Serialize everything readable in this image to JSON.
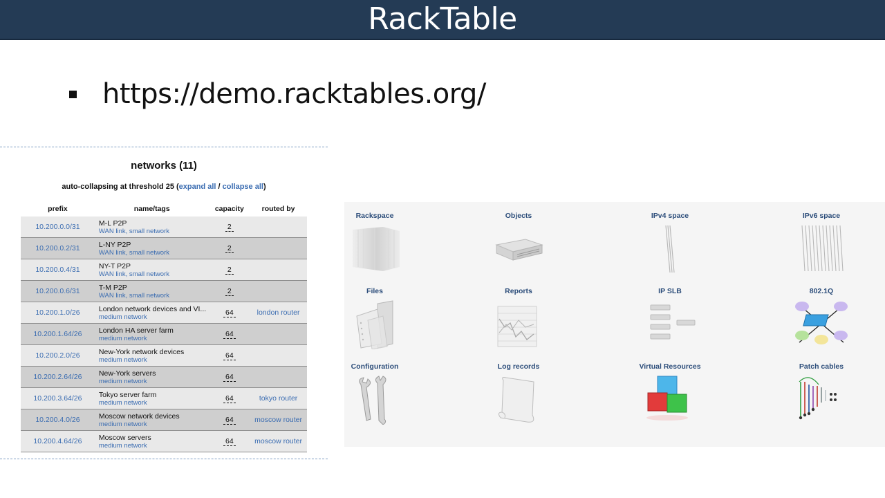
{
  "slide": {
    "title": "RackTable",
    "bullet_url": "https://demo.racktables.org/"
  },
  "networks": {
    "title": "networks (11)",
    "subtitle_prefix": "auto-collapsing at threshold 25 (",
    "expand_all": "expand all",
    "separator": " / ",
    "collapse_all": "collapse all",
    "subtitle_suffix": ")",
    "headers": {
      "prefix": "prefix",
      "name": "name/tags",
      "capacity": "capacity",
      "routed": "routed by"
    },
    "rows": [
      {
        "prefix": "10.200.0.0/31",
        "name": "M-L P2P",
        "tag1": "WAN link",
        "tag2": "small network",
        "capacity": "2",
        "routed": ""
      },
      {
        "prefix": "10.200.0.2/31",
        "name": "L-NY P2P",
        "tag1": "WAN link",
        "tag2": "small network",
        "capacity": "2",
        "routed": ""
      },
      {
        "prefix": "10.200.0.4/31",
        "name": "NY-T P2P",
        "tag1": "WAN link",
        "tag2": "small network",
        "capacity": "2",
        "routed": ""
      },
      {
        "prefix": "10.200.0.6/31",
        "name": "T-M P2P",
        "tag1": "WAN link",
        "tag2": "small network",
        "capacity": "2",
        "routed": ""
      },
      {
        "prefix": "10.200.1.0/26",
        "name": "London network devices and VI...",
        "tag1": "medium network",
        "tag2": "",
        "capacity": "64",
        "routed": "london router"
      },
      {
        "prefix": "10.200.1.64/26",
        "name": "London HA server farm",
        "tag1": "medium network",
        "tag2": "",
        "capacity": "64",
        "routed": ""
      },
      {
        "prefix": "10.200.2.0/26",
        "name": "New-York network devices",
        "tag1": "medium network",
        "tag2": "",
        "capacity": "64",
        "routed": ""
      },
      {
        "prefix": "10.200.2.64/26",
        "name": "New-York servers",
        "tag1": "medium network",
        "tag2": "",
        "capacity": "64",
        "routed": ""
      },
      {
        "prefix": "10.200.3.64/26",
        "name": "Tokyo server farm",
        "tag1": "medium network",
        "tag2": "",
        "capacity": "64",
        "routed": "tokyo router"
      },
      {
        "prefix": "10.200.4.0/26",
        "name": "Moscow network devices",
        "tag1": "medium network",
        "tag2": "",
        "capacity": "64",
        "routed": "moscow router"
      },
      {
        "prefix": "10.200.4.64/26",
        "name": "Moscow servers",
        "tag1": "medium network",
        "tag2": "",
        "capacity": "64",
        "routed": "moscow router"
      }
    ]
  },
  "index": {
    "items": [
      {
        "label": "Rackspace",
        "icon": "rackspace-icon"
      },
      {
        "label": "Objects",
        "icon": "objects-icon"
      },
      {
        "label": "IPv4 space",
        "icon": "ipv4-space-icon"
      },
      {
        "label": "IPv6 space",
        "icon": "ipv6-space-icon"
      },
      {
        "label": "Files",
        "icon": "files-icon"
      },
      {
        "label": "Reports",
        "icon": "reports-icon"
      },
      {
        "label": "IP SLB",
        "icon": "ip-slb-icon"
      },
      {
        "label": "802.1Q",
        "icon": "vlan-8021q-icon"
      },
      {
        "label": "Configuration",
        "icon": "configuration-icon"
      },
      {
        "label": "Log records",
        "icon": "log-records-icon"
      },
      {
        "label": "Virtual Resources",
        "icon": "virtual-resources-icon"
      },
      {
        "label": "Patch cables",
        "icon": "patch-cables-icon"
      }
    ]
  },
  "colors": {
    "title_bar": "#243b55",
    "link": "#3a6cb1",
    "row_light": "#e9e9e9",
    "row_dark": "#cfcfcf"
  }
}
